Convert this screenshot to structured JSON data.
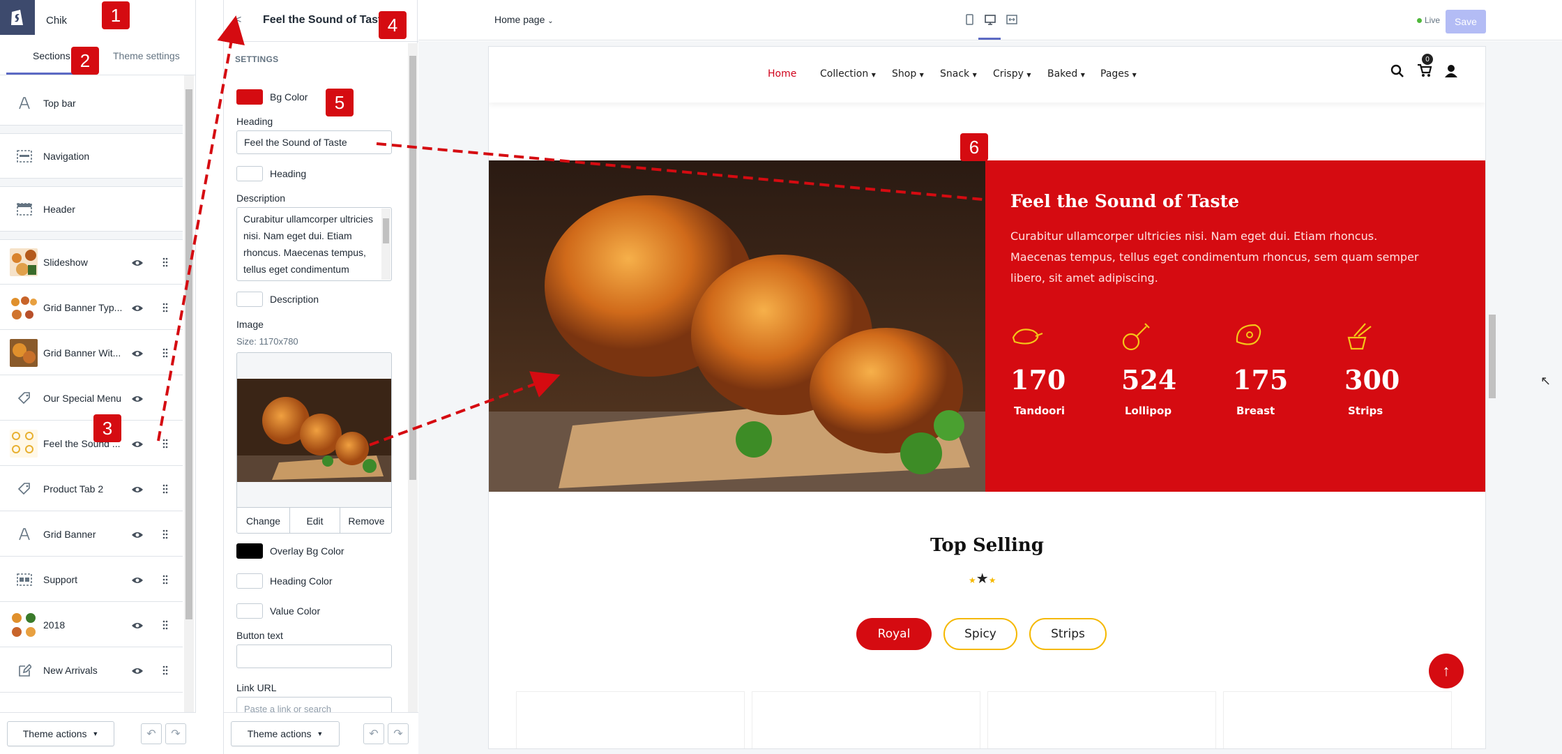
{
  "store": {
    "name": "Chik"
  },
  "left_tabs": {
    "sections": "Sections",
    "theme_settings": "Theme settings"
  },
  "sections": [
    {
      "label": "Top bar",
      "icon": "text-icon"
    },
    {
      "label": "Navigation",
      "icon": "navigation-icon"
    },
    {
      "label": "Header",
      "icon": "header-icon"
    },
    {
      "label": "Slideshow",
      "icon": "thumbnail"
    },
    {
      "label": "Grid Banner Typ...",
      "icon": "thumbnail"
    },
    {
      "label": "Grid Banner Wit...",
      "icon": "thumbnail"
    },
    {
      "label": "Our Special Menu",
      "icon": "tag-icon"
    },
    {
      "label": "Feel the Sound ...",
      "icon": "thumbnail"
    },
    {
      "label": "Product Tab 2",
      "icon": "tag-icon"
    },
    {
      "label": "Grid Banner",
      "icon": "text-icon"
    },
    {
      "label": "Support",
      "icon": "layout-icon"
    },
    {
      "label": "2018",
      "icon": "thumbnail"
    },
    {
      "label": "New Arrivals",
      "icon": "edit-icon"
    }
  ],
  "footer": {
    "theme_actions": "Theme actions"
  },
  "panel": {
    "title": "Feel the Sound of Taste",
    "settings_heading": "SETTINGS",
    "bg_color_label": "Bg Color",
    "heading_label": "Heading",
    "heading_value": "Feel the Sound of Taste",
    "heading_color_label": "Heading",
    "description_label": "Description",
    "description_value": "Curabitur ullamcorper ultricies nisi. Nam eget dui. Etiam rhoncus. Maecenas tempus, tellus eget condimentum",
    "description_color_label": "Description",
    "image_label": "Image",
    "image_size": "Size: 1170x780",
    "change": "Change",
    "edit": "Edit",
    "remove": "Remove",
    "overlay_label": "Overlay Bg Color",
    "heading_color2_label": "Heading Color",
    "value_color_label": "Value Color",
    "button_text_label": "Button text",
    "link_url_label": "Link URL",
    "link_placeholder": "Paste a link or search"
  },
  "colors": {
    "accent": "#d50b11",
    "overlay": "#000000",
    "brand": "#5c6ac4"
  },
  "topbar": {
    "page_select": "Home page",
    "live": "Live",
    "save": "Save"
  },
  "site": {
    "nav": [
      "Home",
      "Collection",
      "Shop",
      "Snack",
      "Crispy",
      "Baked",
      "Pages"
    ],
    "cart_count": "0",
    "banner_heading": "Feel the Sound of Taste",
    "banner_text": "Curabitur ullamcorper ultricies nisi. Nam eget dui. Etiam rhoncus. Maecenas tempus, tellus eget condimentum rhoncus, sem quam semper libero, sit amet adipiscing.",
    "stats": [
      {
        "value": "170",
        "label": "Tandoori"
      },
      {
        "value": "524",
        "label": "Lollipop"
      },
      {
        "value": "175",
        "label": "Breast"
      },
      {
        "value": "300",
        "label": "Strips"
      }
    ],
    "top_selling": "Top Selling",
    "pills": [
      "Royal",
      "Spicy",
      "Strips"
    ]
  },
  "callouts": [
    "1",
    "2",
    "3",
    "4",
    "5",
    "6"
  ]
}
